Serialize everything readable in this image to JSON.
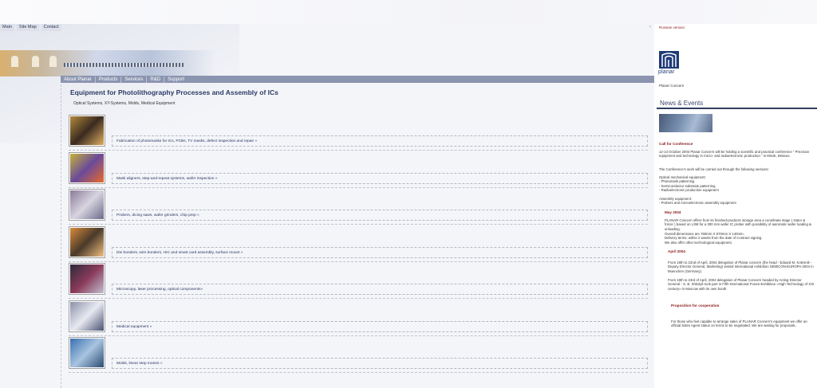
{
  "top_nav": [
    "Main",
    "Site Map",
    "Contact"
  ],
  "main_nav": [
    "About Planar",
    "Products",
    "Services",
    "R&D",
    "Support"
  ],
  "page": {
    "title": "Equipment for Photolithography Processes and Assembly of ICs",
    "subtitle": "Optical Systems, XY-Systems, Molds, Medical Equipment"
  },
  "products": [
    {
      "label": "Fabrication of photomasks for ICs, PCBs, TV masks, defect inspection and repair »",
      "thumb": "photomask-image",
      "colors": [
        "#b38a3c",
        "#3a2a20",
        "#e0b060"
      ]
    },
    {
      "label": "Mask aligners, step-and-repeat systems, wafer inspection »",
      "thumb": "mask-aligner-image",
      "colors": [
        "#c8b23a",
        "#6a4a9a",
        "#e86a2a"
      ]
    },
    {
      "label": "Probers, dicing saws, wafer grinders, chip prep »",
      "thumb": "prober-image",
      "colors": [
        "#8a7a9a",
        "#d8d4e0",
        "#6a6a8a"
      ]
    },
    {
      "label": "Die bonders, wire bonders, HIC and smart card assembly, surface mount »",
      "thumb": "die-bonder-image",
      "colors": [
        "#d88a3a",
        "#4a3a2a",
        "#f0c080"
      ]
    },
    {
      "label": "Microscopy, laser processing, optical components»",
      "thumb": "microscopy-image",
      "colors": [
        "#2a2a3a",
        "#8a3a5a",
        "#c0c0d0"
      ]
    },
    {
      "label": "Medical equipment »",
      "thumb": "medical-equipment-image",
      "colors": [
        "#8a90a8",
        "#e8eaf2",
        "#4a5070"
      ]
    },
    {
      "label": "Molds, linear step motors »",
      "thumb": "molds-image",
      "colors": [
        "#3a70b0",
        "#a8c4e0",
        "#2a4a70"
      ]
    }
  ],
  "sidebar": {
    "russian_link": "Russian version",
    "logo_text": "planar",
    "company": "Planar Concern",
    "news_heading": "News & Events",
    "call_heading": "Call for Conference",
    "call_text": "12-13 October 2004 Planar Concern will be holding a scientific and practical conference \" Precision equipment and technology in micro- and radioelectronic production \" in Minsk, Belarus.",
    "sections_intro": "The Conference's work will be carried out through the following sections:",
    "optical_lines": [
      "Optical mechanical equipment:",
      "- Photomask patterning",
      "- Semiconductor substrate patterning",
      "- Radioelectronic production equipment"
    ],
    "assembly_lines": [
      "Assembly equipment:",
      "- Probers and microelectronic assembly equipment"
    ],
    "may_heading": "May 2004",
    "may_text": "PLANAR Concern offers from its finished-products storage area a coordinate stage ( stator & forcer ) based on LSM for a 300 mm wafer IC prober with possibility of automatic wafer loading & unloading.",
    "may_lines": [
      "Overall dimensions are 760mm X 570mm X 140mm.",
      "Delivery terms: within 2 weeks from the date of Contract signing.",
      "We also offer other technological equipment."
    ],
    "april_heading": "April 2004",
    "april_text1": "From 19th to 22nd of April, 2004 delegation of Planar concern (the head - Eduard M. Kolesnik - Deputy Director General, Marketing) visited International exhibition SEMICON-EUROPA-2004 in Muenchen (Germany).",
    "april_text2": "From 19th to 23rd of April, 2004 delegation of Planar Concern headed by Acting Director General - S. B. Shkolyk took part in Fifth International Forum-Exhibition «High Technology of XXI century» in Moscow with its own booth.",
    "coop_heading": "Proposition for cooperation",
    "coop_text": "For those who feel capable to arrange sales of PLANAR Concern's equipment we offer an official Sales Agent status on terms to be negotiated. We are waiting for proposals."
  }
}
